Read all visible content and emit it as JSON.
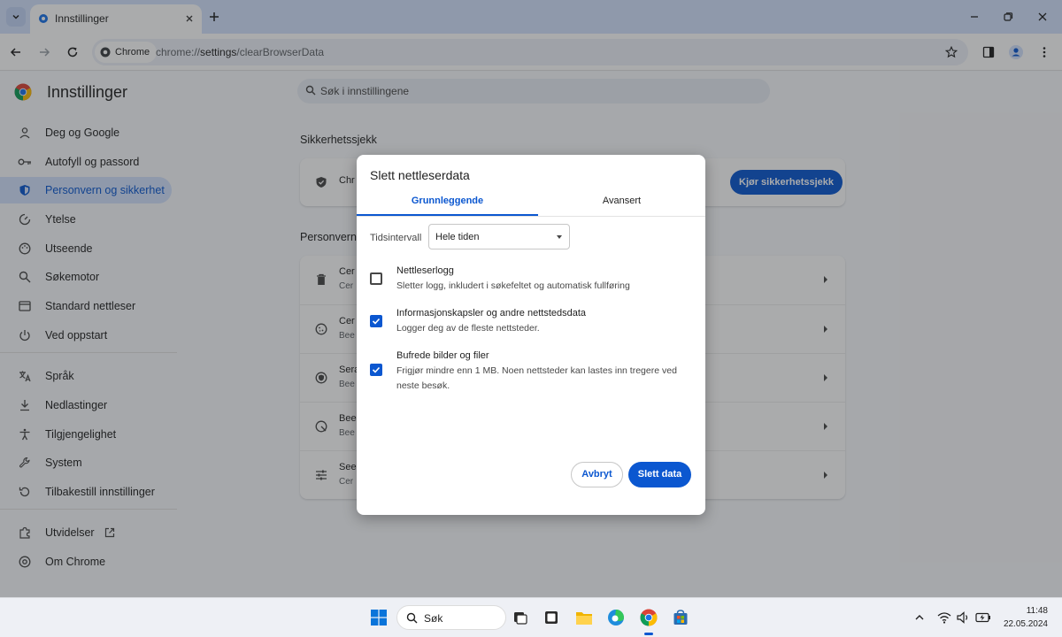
{
  "browser": {
    "tab_title": "Innstillinger",
    "chip_label": "Chrome",
    "url_prefix": "chrome://",
    "url_host": "settings",
    "url_path": "/clearBrowserData"
  },
  "settings": {
    "app_title": "Innstillinger",
    "search_placeholder": "Søk i innstillingene",
    "nav": [
      {
        "label": "Deg og Google",
        "icon": "person-icon"
      },
      {
        "label": "Autofyll og passord",
        "icon": "key-icon"
      },
      {
        "label": "Personvern og sikkerhet",
        "icon": "shield-icon",
        "active": true
      },
      {
        "label": "Ytelse",
        "icon": "speedometer-icon"
      },
      {
        "label": "Utseende",
        "icon": "palette-icon"
      },
      {
        "label": "Søkemotor",
        "icon": "search-icon"
      },
      {
        "label": "Standard nettleser",
        "icon": "browser-icon"
      },
      {
        "label": "Ved oppstart",
        "icon": "power-icon"
      },
      {
        "label": "Språk",
        "icon": "translate-icon"
      },
      {
        "label": "Nedlastinger",
        "icon": "download-icon"
      },
      {
        "label": "Tilgjengelighet",
        "icon": "accessibility-icon"
      },
      {
        "label": "System",
        "icon": "wrench-icon"
      },
      {
        "label": "Tilbakestill innstillinger",
        "icon": "reset-icon"
      },
      {
        "label": "Utvidelser",
        "icon": "puzzle-icon"
      },
      {
        "label": "Om Chrome",
        "icon": "chrome-icon"
      }
    ],
    "safety_title": "Sikkerhetssjekk",
    "safety_row_text": "Chr",
    "safety_button": "Kjør sikkerhetssjekk",
    "privacy_title": "Personvern o",
    "privacy_rows": [
      {
        "t": "Cer",
        "s": "Cer",
        "icon": "trash-icon"
      },
      {
        "t": "Cer",
        "s": "Bee",
        "icon": "cookie-icon"
      },
      {
        "t": "Sera",
        "s": "Bee",
        "icon": "security-icon"
      },
      {
        "t": "Bee",
        "s": "Bee",
        "icon": "sandbox-icon"
      },
      {
        "t": "See",
        "s": "Cer",
        "icon": "tune-icon"
      }
    ]
  },
  "dialog": {
    "title": "Slett nettleserdata",
    "tab_basic": "Grunnleggende",
    "tab_advanced": "Avansert",
    "time_range_label": "Tidsintervall",
    "time_range_value": "Hele tiden",
    "options": [
      {
        "title": "Nettleserlogg",
        "sub": "Sletter logg, inkludert i søkefeltet og automatisk fullføring",
        "checked": false
      },
      {
        "title": "Informasjonskapsler og andre nettstedsdata",
        "sub": "Logger deg av de fleste nettsteder.",
        "checked": true
      },
      {
        "title": "Bufrede bilder og filer",
        "sub": "Frigjør mindre enn 1 MB. Noen nettsteder kan lastes inn tregere ved neste besøk.",
        "checked": true
      }
    ],
    "cancel_label": "Avbryt",
    "confirm_label": "Slett data"
  },
  "taskbar": {
    "search_label": "Søk",
    "time": "11:48",
    "date": "22.05.2024"
  },
  "colors": {
    "accent": "#0b57d0",
    "tabstrip": "#d3e3fd",
    "active_nav": "#d3e3fd"
  }
}
